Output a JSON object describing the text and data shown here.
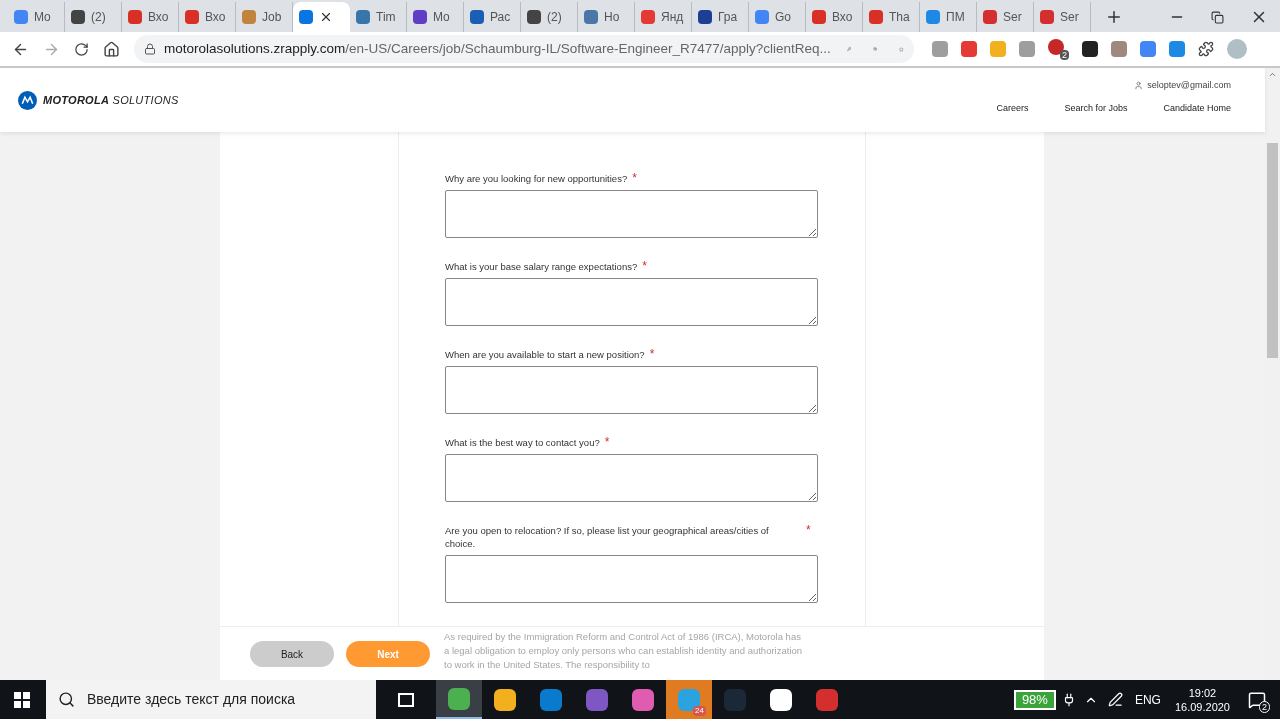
{
  "browser": {
    "tabs": [
      {
        "title": "Mo",
        "color": "#4285f4",
        "selected": false
      },
      {
        "title": "(2)",
        "color": "#444444",
        "selected": false
      },
      {
        "title": "Вхо",
        "color": "#d93025",
        "selected": false
      },
      {
        "title": "Вхо",
        "color": "#d93025",
        "selected": false
      },
      {
        "title": "Job",
        "color": "#c0843f",
        "selected": false
      },
      {
        "color": "#0875e1",
        "selected": true
      },
      {
        "title": "Tim",
        "color": "#3776ab",
        "selected": false
      },
      {
        "title": "Mo",
        "color": "#5f3dc4",
        "selected": false
      },
      {
        "title": "Рас",
        "color": "#1a5fb4",
        "selected": false
      },
      {
        "title": "(2)",
        "color": "#444444",
        "selected": false
      },
      {
        "title": "Но",
        "color": "#4a76a8",
        "selected": false
      },
      {
        "title": "Янд",
        "color": "#e53935",
        "selected": false
      },
      {
        "title": "Гра",
        "color": "#1c3f94",
        "selected": false
      },
      {
        "title": "Go",
        "color": "#4285f4",
        "selected": false
      },
      {
        "title": "Вхо",
        "color": "#d93025",
        "selected": false
      },
      {
        "title": "Tha",
        "color": "#d93025",
        "selected": false
      },
      {
        "title": "ПМ",
        "color": "#1e88e5",
        "selected": false
      },
      {
        "title": "Ser",
        "color": "#d32f2f",
        "selected": false
      },
      {
        "title": "Ser",
        "color": "#d32f2f",
        "selected": false
      }
    ],
    "address": {
      "host": "motorolasolutions.zrapply.com",
      "path": "/en-US/Careers/job/Schaumburg-IL/Software-Engineer_R7477/apply?clientReq..."
    },
    "extension_badge": "2"
  },
  "site": {
    "brand": {
      "name": "MOTOROLA",
      "suffix": "SOLUTIONS"
    },
    "user_email": "seloptev@gmail.com",
    "nav": [
      "Careers",
      "Search for Jobs",
      "Candidate Home"
    ]
  },
  "form": {
    "required_mark": "*",
    "questions": [
      {
        "label": "Why are you looking for new opportunities?",
        "required": true
      },
      {
        "label": "What is your base salary range expectations?",
        "required": true
      },
      {
        "label": "When are you available to start a new position?",
        "required": true
      },
      {
        "label": "What is the best way to contact you?",
        "required": true
      },
      {
        "label": "Are you open to relocation? If so, please list your geographical areas/cities of choice.",
        "required": true
      }
    ],
    "notice": "As required by the Immigration Reform and Control Act of 1986 (IRCA), Motorola has a legal obligation to employ only persons who can establish identity and authorization to work in the United States. The responsibility to"
  },
  "buttons": [
    {
      "label": "Back",
      "kind": "secondary"
    },
    {
      "label": "Next",
      "kind": "primary"
    }
  ],
  "taskbar": {
    "search_placeholder": "Введите здесь текст для поиска",
    "apps": [
      {
        "color": "#4caf50",
        "selected": true,
        "flashing": false
      },
      {
        "color": "#f2b01e",
        "selected": false,
        "flashing": false
      },
      {
        "color": "#0a7acc",
        "selected": false,
        "flashing": false
      },
      {
        "color": "#7e57c2",
        "selected": false,
        "flashing": false
      },
      {
        "color": "#e05cb0",
        "selected": false,
        "flashing": false
      },
      {
        "color": "#2aa3de",
        "selected": false,
        "flashing": true,
        "badge": "24"
      },
      {
        "color": "#1b2838",
        "selected": false,
        "flashing": false
      },
      {
        "color": "#ffffff",
        "selected": false,
        "flashing": false
      },
      {
        "color": "#d32f2f",
        "selected": false,
        "flashing": false
      }
    ],
    "battery": "98%",
    "language": "ENG",
    "time": "19:02",
    "date": "16.09.2020",
    "notifications": "2"
  }
}
